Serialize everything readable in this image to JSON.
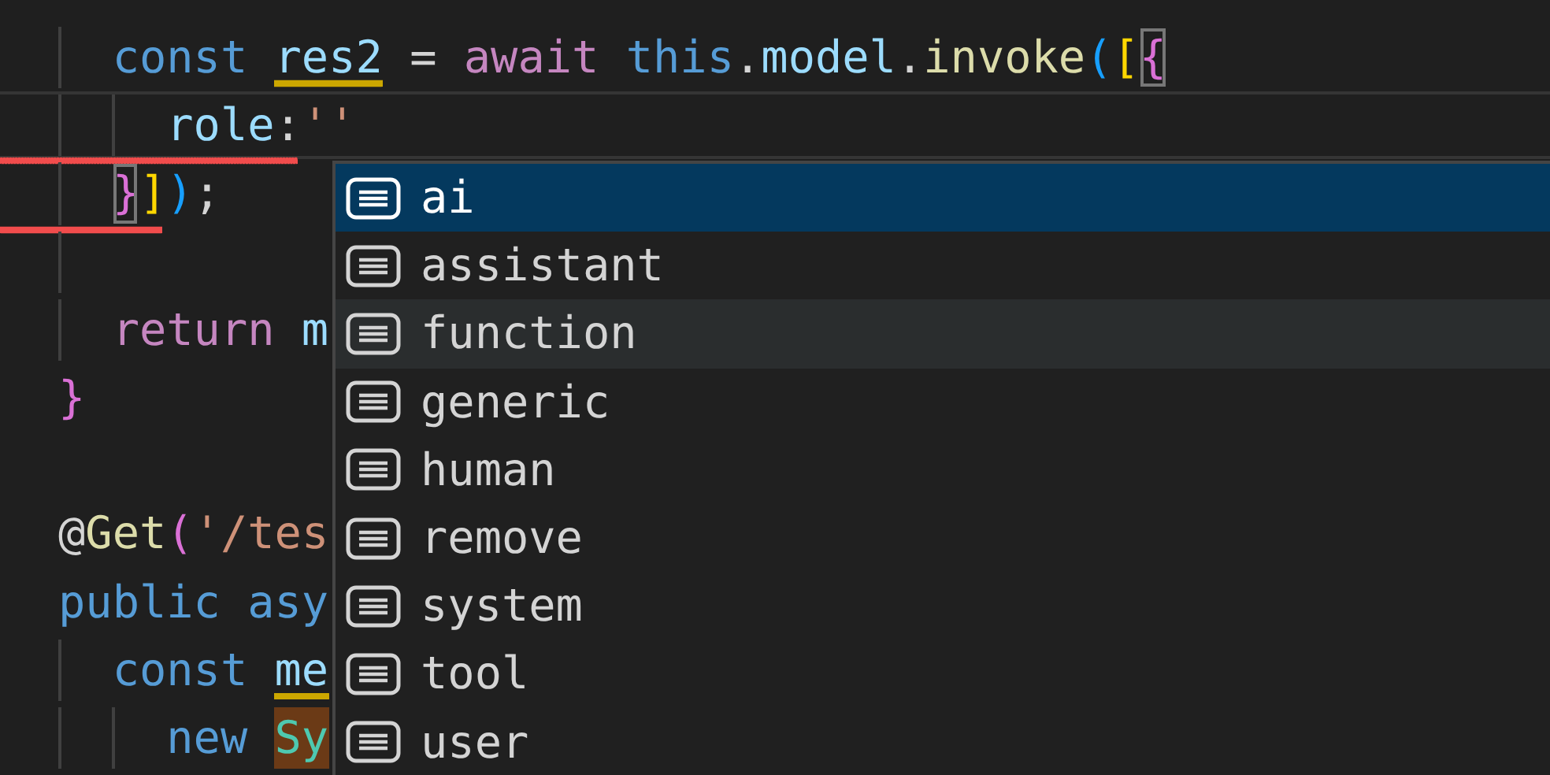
{
  "editor": {
    "lines": [
      {
        "indented": true,
        "current": false,
        "error": false,
        "tokens": [
          {
            "text": "const",
            "kind": "keyword"
          },
          {
            "text": "res2",
            "kind": "variable",
            "space": true,
            "warning": true
          },
          {
            "text": "=",
            "kind": "plain",
            "space": true
          },
          {
            "text": "await",
            "kind": "control",
            "space": true
          },
          {
            "text": "this",
            "kind": "keyword",
            "space": true
          },
          {
            "text": ".",
            "kind": "plain"
          },
          {
            "text": "model",
            "kind": "variable"
          },
          {
            "text": ".",
            "kind": "plain"
          },
          {
            "text": "invoke",
            "kind": "function"
          },
          {
            "text": "(",
            "kind": "bracket3"
          },
          {
            "text": "[",
            "kind": "bracket1"
          },
          {
            "text": "{",
            "kind": "bracket2",
            "boxed": true
          }
        ]
      },
      {
        "indented": true,
        "nested": true,
        "current": true,
        "error": true,
        "tokens": [
          {
            "text": "role",
            "kind": "variable"
          },
          {
            "text": ":",
            "kind": "plain"
          },
          {
            "text": "''",
            "kind": "string"
          }
        ]
      },
      {
        "indented": true,
        "current": false,
        "error": true,
        "tokens": [
          {
            "text": "}",
            "kind": "bracket2",
            "boxed": true
          },
          {
            "text": "]",
            "kind": "bracket1"
          },
          {
            "text": ")",
            "kind": "bracket3"
          },
          {
            "text": ";",
            "kind": "plain"
          }
        ]
      },
      {
        "indented": true,
        "current": false,
        "error": false
      },
      {
        "indented": true,
        "current": false,
        "error": false,
        "tokens": [
          {
            "text": "return",
            "kind": "control"
          },
          {
            "text": "m",
            "kind": "variable",
            "space": true
          }
        ]
      },
      {
        "current": false,
        "error": false,
        "tokens": [
          {
            "text": "}",
            "kind": "bracket2"
          }
        ]
      },
      {
        "current": false,
        "error": false
      },
      {
        "current": false,
        "error": false,
        "tokens": [
          {
            "text": "@",
            "kind": "plain"
          },
          {
            "text": "Get",
            "kind": "function"
          },
          {
            "text": "(",
            "kind": "bracket2"
          },
          {
            "text": "'/tes",
            "kind": "string"
          }
        ]
      },
      {
        "current": false,
        "error": false,
        "tokens": [
          {
            "text": "public",
            "kind": "keyword"
          },
          {
            "text": "asy",
            "kind": "keyword",
            "space": true
          }
        ]
      },
      {
        "indented": true,
        "current": false,
        "error": false,
        "tokens": [
          {
            "text": "const",
            "kind": "keyword"
          },
          {
            "text": "me",
            "kind": "variable",
            "space": true,
            "warning": true
          }
        ]
      },
      {
        "indented": true,
        "nested": true,
        "current": false,
        "error": false,
        "tokens": [
          {
            "text": "new",
            "kind": "keyword"
          },
          {
            "text": "Sy",
            "kind": "type",
            "space": true,
            "highlight": true
          }
        ]
      }
    ]
  },
  "suggestions": [
    {
      "label": "ai",
      "selected": true,
      "hovered": false
    },
    {
      "label": "assistant",
      "selected": false,
      "hovered": false
    },
    {
      "label": "function",
      "selected": false,
      "hovered": true
    },
    {
      "label": "generic",
      "selected": false,
      "hovered": false
    },
    {
      "label": "human",
      "selected": false,
      "hovered": false
    },
    {
      "label": "remove",
      "selected": false,
      "hovered": false
    },
    {
      "label": "system",
      "selected": false,
      "hovered": false
    },
    {
      "label": "tool",
      "selected": false,
      "hovered": false
    },
    {
      "label": "user",
      "selected": false,
      "hovered": false
    }
  ]
}
